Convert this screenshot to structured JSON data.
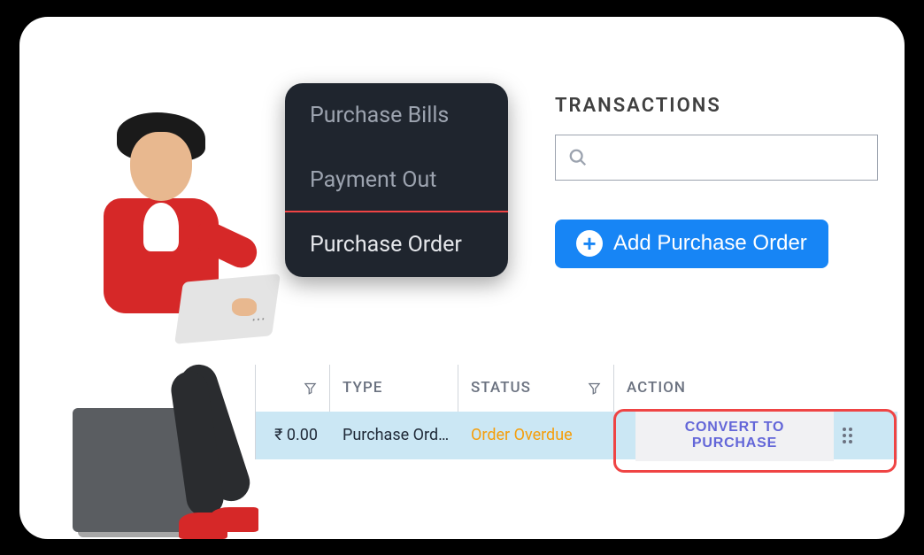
{
  "menu": {
    "items": [
      {
        "label": "Purchase Bills"
      },
      {
        "label": "Payment Out"
      },
      {
        "label": "Purchase Order"
      }
    ]
  },
  "transactions": {
    "heading": "TRANSACTIONS",
    "search_placeholder": "",
    "add_button_label": "Add Purchase Order"
  },
  "table": {
    "headers": {
      "type": "TYPE",
      "status": "STATUS",
      "action": "ACTION"
    },
    "row": {
      "amount": "₹ 0.00",
      "type": "Purchase Ord…",
      "status": "Order Overdue",
      "action_label": "CONVERT TO PURCHASE"
    }
  }
}
